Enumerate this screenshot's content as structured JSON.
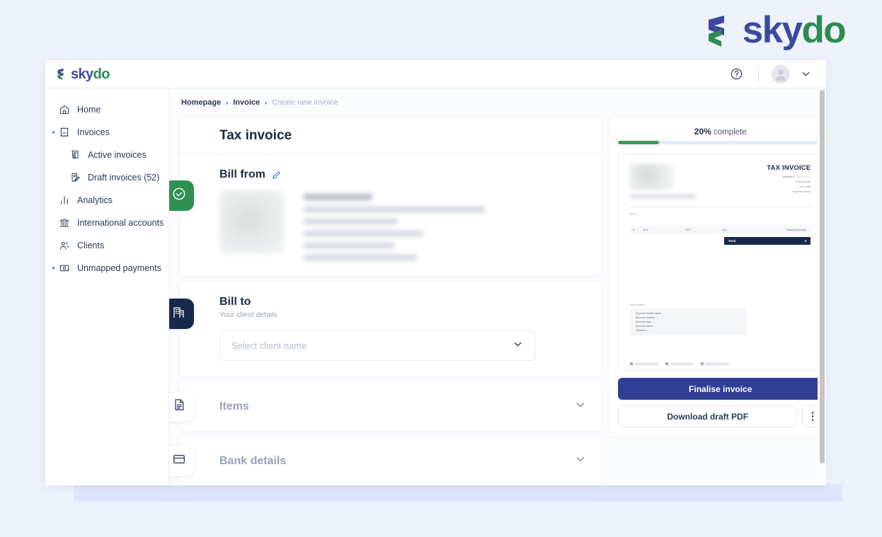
{
  "brand": {
    "name_part1": "sky",
    "name_part2": "do",
    "logo_icon": "skydo-chevron-logo",
    "color_primary": "#3b4a9c",
    "color_accent": "#2e8b52"
  },
  "header": {
    "help_icon": "question-circle-icon",
    "avatar_icon": "user-avatar-icon",
    "caret_icon": "chevron-down-icon"
  },
  "sidebar": {
    "items": [
      {
        "label": "Home",
        "icon": "home-icon",
        "sub": false,
        "expandable": false
      },
      {
        "label": "Invoices",
        "icon": "invoice-icon",
        "sub": false,
        "expandable": true
      },
      {
        "label": "Active invoices",
        "icon": "active-invoice-icon",
        "sub": true,
        "expandable": false
      },
      {
        "label": "Draft invoices (52)",
        "icon": "draft-invoice-icon",
        "sub": true,
        "expandable": false
      },
      {
        "label": "Analytics",
        "icon": "analytics-bars-icon",
        "sub": false,
        "expandable": false
      },
      {
        "label": "International accounts",
        "icon": "bank-institution-icon",
        "sub": false,
        "expandable": false
      },
      {
        "label": "Clients",
        "icon": "people-icon",
        "sub": false,
        "expandable": false
      },
      {
        "label": "Unmapped payments",
        "icon": "payment-card-icon",
        "sub": false,
        "expandable": true
      }
    ]
  },
  "breadcrumb": {
    "items": [
      "Homepage",
      "Invoice",
      "Create new invoice"
    ],
    "separator": "›"
  },
  "main": {
    "page_title": "Tax invoice",
    "bill_from": {
      "title": "Bill from",
      "edit_icon": "pencil-edit-icon",
      "step_icon": "check-circle-icon",
      "status": "complete",
      "details_redacted": true
    },
    "bill_to": {
      "title": "Bill to",
      "subtitle": "Your client details",
      "step_icon": "building-icon",
      "select_placeholder": "Select client name",
      "select_value": "",
      "chevron_icon": "chevron-down-icon"
    },
    "items_section": {
      "title": "Items",
      "icon": "document-lines-icon",
      "chevron_icon": "chevron-down-icon",
      "collapsed": true
    },
    "bank_section": {
      "title": "Bank details",
      "icon": "credit-card-icon",
      "chevron_icon": "chevron-down-icon",
      "collapsed": true
    }
  },
  "right_panel": {
    "progress_percent": "20%",
    "progress_label": "complete",
    "progress_value": 20,
    "progress_color": "#3f9a5f",
    "preview": {
      "doc_title": "TAX INVOICE",
      "meta": [
        {
          "label": "Invoice #",
          "value": "Draft invoice"
        },
        {
          "label": "Invoice Date",
          "value": ""
        },
        {
          "label": "Due Date",
          "value": ""
        },
        {
          "label": "Payment terms",
          "value": ""
        }
      ],
      "bill_to_label": "Bill to",
      "table_headers": [
        "#",
        "Item",
        "SAC",
        "Qty",
        "Rate()",
        "Amount()"
      ],
      "total_label": "Total",
      "total_value": "0",
      "bank_label": "Bank details",
      "bank_fields": [
        "Account holder name :",
        "Account number : -",
        "Account type : -",
        "Account name : -",
        "Address : -"
      ]
    },
    "finalise_button": "Finalise invoice",
    "download_button": "Download draft PDF",
    "kebab_icon": "more-options-icon"
  }
}
